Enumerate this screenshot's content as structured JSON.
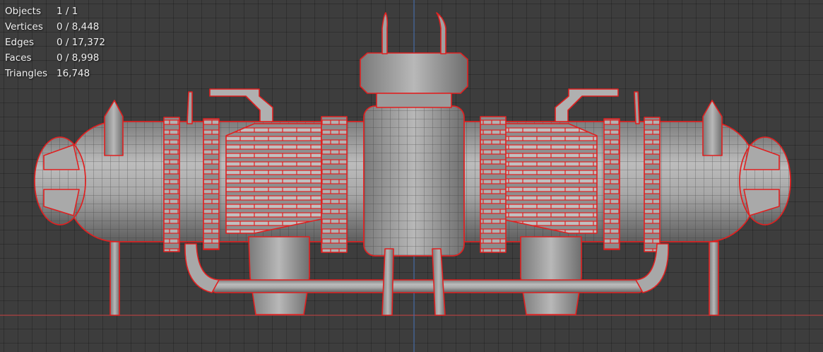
{
  "stats": {
    "objects": {
      "label": "Objects",
      "value": "1 / 1"
    },
    "vertices": {
      "label": "Vertices",
      "value": "0 / 8,448"
    },
    "edges": {
      "label": "Edges",
      "value": "0 / 17,372"
    },
    "faces": {
      "label": "Faces",
      "value": "0 / 8,998"
    },
    "triangles": {
      "label": "Triangles",
      "value": "16,748"
    }
  },
  "colors": {
    "background": "#3d3d3d",
    "grid": "#333333",
    "x_axis": "#b34545",
    "z_axis": "#4a6fa8",
    "wire_selected": "#e02020",
    "mesh_fill": "#9a9a9a"
  },
  "scene": {
    "view": "front-orthographic",
    "mode": "edit",
    "selection_outline": "red"
  }
}
